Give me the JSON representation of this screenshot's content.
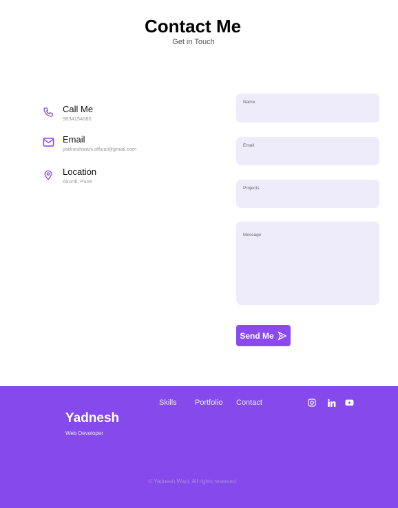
{
  "header": {
    "title": "Contact Me",
    "subtitle": "Get in Touch"
  },
  "contact_info": [
    {
      "icon": "phone-icon",
      "label": "Call Me",
      "value": "9834154085"
    },
    {
      "icon": "mail-icon",
      "label": "Email",
      "value": "yadneshwani.offical@gmail.com"
    },
    {
      "icon": "location-icon",
      "label": "Location",
      "value": "Akurdi, Pune"
    }
  ],
  "form": {
    "name_placeholder": "Name",
    "email_placeholder": "Email",
    "projects_placeholder": "Projects",
    "message_placeholder": "Message",
    "submit_label": "Send Me"
  },
  "footer": {
    "brand": "Yadnesh",
    "role": "Web Developer",
    "nav": [
      "Skills",
      "Portfolio",
      "Contact"
    ],
    "social": [
      "instagram-icon",
      "linkedin-icon",
      "youtube-icon"
    ],
    "copyright": "© Yadnesh Wani. All rights reserved."
  },
  "colors": {
    "accent": "#8549ec",
    "field_bg": "#eeebfb"
  }
}
